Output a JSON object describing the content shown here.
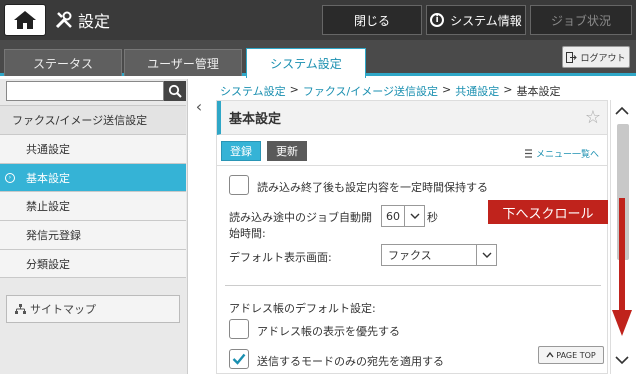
{
  "header": {
    "title": "設定",
    "close_label": "閉じる",
    "sysinfo_label": "システム情報",
    "jobstatus_label": "ジョブ状況"
  },
  "tabs": [
    {
      "label": "ステータス"
    },
    {
      "label": "ユーザー管理"
    },
    {
      "label": "システム設定"
    }
  ],
  "logout_label": "ログアウト",
  "sidebar": {
    "search_value": "",
    "items": [
      {
        "label": "ファクス/イメージ送信設定",
        "type": "header"
      },
      {
        "label": "共通設定",
        "type": "sub"
      },
      {
        "label": "基本設定",
        "type": "sub",
        "active": true
      },
      {
        "label": "禁止設定",
        "type": "sub"
      },
      {
        "label": "発信元登録",
        "type": "sub"
      },
      {
        "label": "分類設定",
        "type": "sub"
      }
    ],
    "sitemap_label": "サイトマップ"
  },
  "breadcrumb": {
    "c1": "システム設定",
    "c2": "ファクス/イメージ送信設定",
    "c3": "共通設定",
    "c4": "基本設定",
    "sep": ">"
  },
  "panel": {
    "title": "基本設定",
    "register_label": "登録",
    "update_label": "更新",
    "menu_list_label": "メニュー一覧へ",
    "keep_settings_label": "読み込み終了後も設定内容を一定時間保持する",
    "keep_settings_checked": false,
    "auto_start_label_1": "読み込み途中のジョブ自動開",
    "auto_start_label_2": "始時間:",
    "auto_start_value": "60",
    "auto_start_unit": "秒",
    "default_screen_label": "デフォルト表示画面:",
    "default_screen_value": "ファクス",
    "addressbook_section_label": "アドレス帳のデフォルト設定:",
    "addressbook_priority_label": "アドレス帳の表示を優先する",
    "addressbook_priority_checked": false,
    "send_mode_only_label": "送信するモードのみの宛先を適用する",
    "send_mode_only_checked": true
  },
  "page_top_label": "PAGE TOP",
  "callout_label": "下へスクロール",
  "colors": {
    "accent": "#35b3d6",
    "callout": "#c0231c",
    "topbar": "#3a3a3a"
  }
}
